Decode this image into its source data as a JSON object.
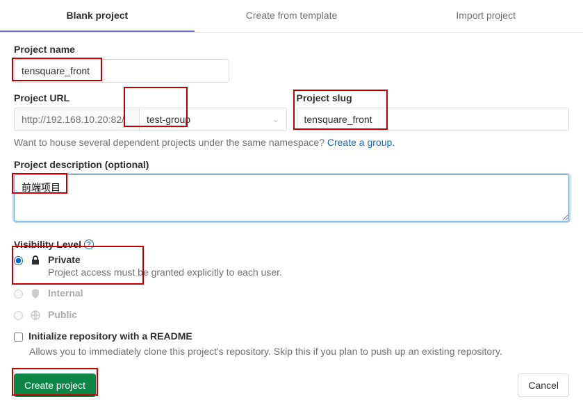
{
  "tabs": {
    "blank": "Blank project",
    "template": "Create from template",
    "import": "Import project"
  },
  "labels": {
    "project_name": "Project name",
    "project_url": "Project URL",
    "project_slug": "Project slug",
    "description": "Project description (optional)",
    "visibility": "Visibility Level",
    "init_readme": "Initialize repository with a README"
  },
  "values": {
    "project_name": "tensquare_front",
    "url_base": "http://192.168.10.20:82/",
    "group": "test-group",
    "slug": "tensquare_front",
    "description": "前端项目"
  },
  "hints": {
    "namespace": "Want to house several dependent projects under the same namespace? ",
    "create_group": "Create a group.",
    "readme_desc": "Allows you to immediately clone this project's repository. Skip this if you plan to push up an existing repository."
  },
  "visibility": {
    "private": {
      "label": "Private",
      "desc": "Project access must be granted explicitly to each user."
    },
    "internal": {
      "label": "Internal"
    },
    "public": {
      "label": "Public"
    }
  },
  "buttons": {
    "create": "Create project",
    "cancel": "Cancel"
  }
}
